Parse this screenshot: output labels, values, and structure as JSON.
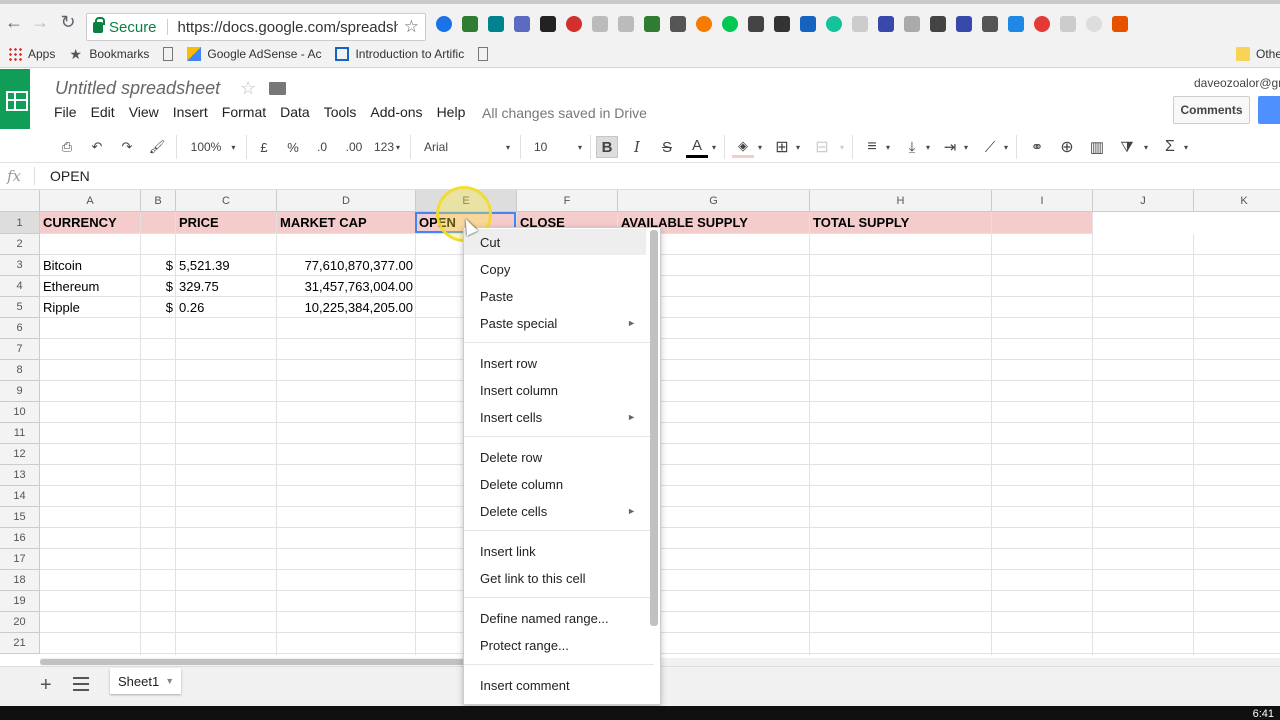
{
  "browser": {
    "secure_label": "Secure",
    "url": "https://docs.google.com/spreadsh...",
    "bookmarks": [
      "Apps",
      "Bookmarks",
      "Google AdSense - Ac",
      "Introduction to Artific",
      "Othe"
    ]
  },
  "app": {
    "title": "Untitled spreadsheet",
    "user": "daveozoalor@gm",
    "comments_label": "Comments",
    "menu": [
      "File",
      "Edit",
      "View",
      "Insert",
      "Format",
      "Data",
      "Tools",
      "Add-ons",
      "Help"
    ],
    "save_status": "All changes saved in Drive"
  },
  "toolbar": {
    "zoom": "100%",
    "currency": "£",
    "percent": "%",
    "dec_less": ".0",
    "dec_more": ".00",
    "more_formats": "123",
    "font": "Arial",
    "font_size": "10",
    "bold": "B",
    "italic": "I",
    "strike": "S",
    "text_color": "A"
  },
  "formula_bar": {
    "fx": "fx",
    "value": "OPEN"
  },
  "grid": {
    "columns": [
      "A",
      "B",
      "C",
      "D",
      "E",
      "F",
      "G",
      "H",
      "I",
      "J",
      "K"
    ],
    "rows": [
      "1",
      "2",
      "3",
      "4",
      "5",
      "6",
      "7",
      "8",
      "9",
      "10",
      "11",
      "12",
      "13",
      "14",
      "15",
      "16",
      "17",
      "18",
      "19",
      "20",
      "21"
    ],
    "header_row": {
      "currency": "CURRENCY",
      "price": "PRICE",
      "market_cap": "MARKET CAP",
      "open": "OPEN",
      "close": "CLOSE",
      "available_supply": "AVAILABLE SUPPLY",
      "total_supply": "TOTAL SUPPLY"
    },
    "data_rows": [
      {
        "currency": "Bitcoin",
        "symbol": "$",
        "price": "5,521.39",
        "market_cap": "77,610,870,377.00"
      },
      {
        "currency": "Ethereum",
        "symbol": "$",
        "price": "329.75",
        "market_cap": "31,457,763,004.00"
      },
      {
        "currency": "Ripple",
        "symbol": "$",
        "price": "0.26",
        "market_cap": "10,225,384,205.00"
      }
    ],
    "header_fill": "#f4cccc",
    "selection_color": "#4285f4"
  },
  "context_menu": {
    "items": [
      {
        "label": "Cut"
      },
      {
        "label": "Copy"
      },
      {
        "label": "Paste"
      },
      {
        "label": "Paste special",
        "submenu": "►"
      },
      {
        "label": "Insert row"
      },
      {
        "label": "Insert column"
      },
      {
        "label": "Insert cells",
        "submenu": "►"
      },
      {
        "label": "Delete row"
      },
      {
        "label": "Delete column"
      },
      {
        "label": "Delete cells",
        "submenu": "►"
      },
      {
        "label": "Insert link"
      },
      {
        "label": "Get link to this cell"
      },
      {
        "label": "Define named range..."
      },
      {
        "label": "Protect range..."
      },
      {
        "label": "Insert comment"
      }
    ]
  },
  "sheets": {
    "active": "Sheet1",
    "add_symbol": "+"
  },
  "taskbar": {
    "clock": "6:41"
  }
}
